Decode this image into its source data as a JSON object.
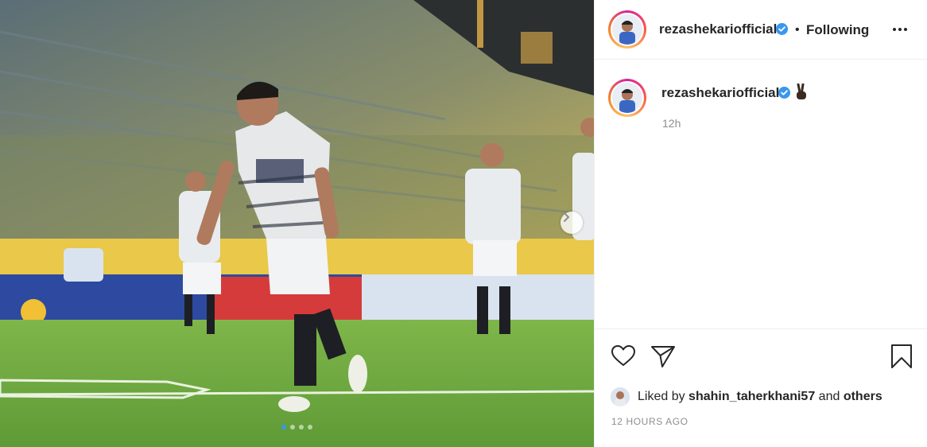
{
  "post": {
    "photo_icon": "carousel-photo",
    "carousel_count": 4,
    "carousel_active_index": 0
  },
  "header": {
    "username": "rezashekariofficial",
    "separator": "•",
    "follow_status": "Following",
    "more_icon": "more-horizontal-icon"
  },
  "caption": {
    "username": "rezashekariofficial",
    "emoji": "victory-hand-emoji",
    "time": "12h"
  },
  "actions": {
    "like_icon": "heart-icon",
    "share_icon": "paper-plane-icon",
    "save_icon": "bookmark-icon"
  },
  "likes": {
    "prefix": "Liked by ",
    "user": "shahin_taherkhani57",
    "middle": " and ",
    "others": "others"
  },
  "timestamp": "12 HOURS AGO",
  "colors": {
    "verified": "#3897f0",
    "text": "#262626",
    "muted": "#8e8e8e",
    "border": "#efefef"
  }
}
